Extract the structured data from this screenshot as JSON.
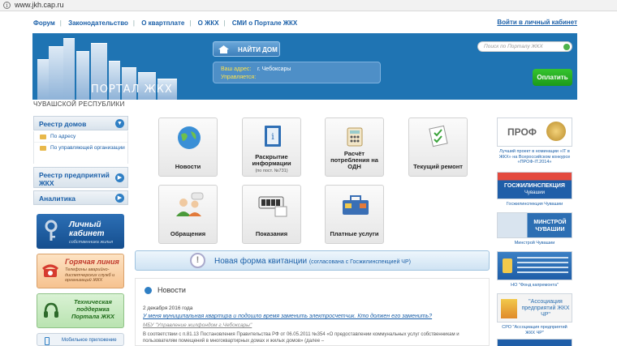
{
  "browser": {
    "url": "www.jkh.cap.ru",
    "info_glyph": "i"
  },
  "topnav": {
    "items": [
      "Форум",
      "Законодательство",
      "О квартплате",
      "О ЖКХ",
      "СМИ о Портале ЖКХ"
    ],
    "login": "Войти в личный кабинет"
  },
  "header": {
    "portal_title": "ПОРТАЛ ЖКХ",
    "region": "ЧУВАШСКОЙ РЕСПУБЛИКИ",
    "find_home": "НАЙТИ ДОМ",
    "address_label": "Ваш адрес:",
    "address_value": "г. Чебоксары",
    "manager_label": "Управляется:",
    "search_placeholder": "Поиск по Порталу ЖКХ",
    "pay": "Оплатить"
  },
  "sidebar": {
    "houses": "Реестр домов",
    "by_address": "По адресу",
    "by_company": "По управляющей организации",
    "companies": "Реестр предприятий ЖКХ",
    "analytics": "Аналитика",
    "cabinet_title": "Личный кабинет",
    "cabinet_sub": "собственника жилья",
    "hotline_title": "Горячая линия",
    "hotline_sub": "Телефоны аварийно-диспетчерских служб и организаций ЖКХ",
    "support_title": "Техническая поддержка Портала ЖКХ",
    "mobile": "Мобильное приложение"
  },
  "tiles": {
    "news": "Новости",
    "disclosure": "Раскрытие информации",
    "disclosure_sub": "(по пост. №731)",
    "calc": "Расчёт потребления на ОДН",
    "repair": "Текущий ремонт",
    "appeals": "Обращения",
    "readings": "Показания",
    "paid": "Платные услуги"
  },
  "receipt": {
    "title": "Новая форма квитанции",
    "note": "(согласована с Госжилинспекцией ЧР)"
  },
  "news": {
    "heading": "Новости",
    "date": "2 декабря 2016 года",
    "title": "У меня муниципальная квартира и подошло время заменить электросчетчик. Кто должен его заменить?",
    "source": "МБУ \"Управление жилфондом г.Чебоксары\"",
    "body": "В соответствии с п.81.13 Постановления Правительства РФ от 06.05.2011 №354 «О предоставлении коммунальных услуг собственникам и пользователям помещений в многоквартирных домах и жилых домов» (далее –"
  },
  "right": {
    "award_caption": "Лучший проект в номинации «IT в ЖКХ» на Всероссийском конкурсе «ПРОФ-IT.2014»",
    "award_logo": "ПРОФ",
    "gji_logo": "ГОСЖИЛИНСПЕКЦИЯ",
    "gji_logo2": "Чувашии",
    "gji_caption": "Госжилинспекция Чувашии",
    "minstroy_logo": "МИНСТРОЙ",
    "minstroy_logo2": "ЧУВАШИИ",
    "minstroy_caption": "Минстрой Чувашии",
    "fund_caption": "НО \"Фонд капремонта\"",
    "assoc_logo": "\"Ассоциация предприятий ЖКХ ЧР\"",
    "assoc_caption": "СРО \"Ассоциация предприятий ЖКХ ЧР\""
  }
}
